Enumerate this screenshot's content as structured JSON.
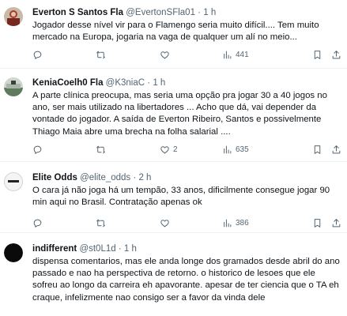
{
  "tweets": [
    {
      "name": "Everton S Santos Fla",
      "handle": "@EvertonSFla01",
      "separator": "·",
      "time": "1 h",
      "text": "Jogador desse nível vir para o Flamengo seria muito difícil.... Tem muito mercado na Europa, jogaria na vaga de qualquer um alí no meio...",
      "replies": "",
      "retweets": "",
      "likes": "",
      "views": "441",
      "avatar_color": "#a83a2e"
    },
    {
      "name": "KeniaCoelh0 Fla",
      "handle": "@K3niaC",
      "separator": "·",
      "time": "1 h",
      "text": "A parte clínica preocupa, mas seria uma opção pra jogar 30 a 40 jogos no ano, ser mais utilizado na libertadores ... Acho que dá, vai depender da vontade do jogador. A saída de Everton Ribeiro, Santos e possivelmente Thiago Maia abre uma brecha na folha salarial ....",
      "replies": "",
      "retweets": "",
      "likes": "2",
      "views": "635",
      "avatar_color": "#8a9a8c"
    },
    {
      "name": "Elite Odds",
      "handle": "@elite_odds",
      "separator": "·",
      "time": "2 h",
      "text": "O cara já não joga há um tempão, 33 anos, dificilmente consegue jogar 90 min aqui no Brasil. Contratação apenas ok",
      "replies": "",
      "retweets": "",
      "likes": "",
      "views": "386",
      "avatar_color": "#f2f2f2"
    },
    {
      "name": "indifferent",
      "handle": "@st0L1d",
      "separator": "·",
      "time": "1 h",
      "text": "dispensa comentarios, mas ele anda longe dos gramados desde abril do ano passado e nao ha perspectiva de retorno. o historico de lesoes que ele sofreu ao longo da carreira eh apavorante. apesar de ter ciencia que o TA eh craque, infelizmente nao consigo ser a favor da vinda dele",
      "avatar_color": "#0a0a0a"
    }
  ],
  "icons": {
    "reply": "reply-icon",
    "retweet": "retweet-icon",
    "like": "heart-icon",
    "views": "views-icon",
    "bookmark": "bookmark-icon",
    "share": "share-icon"
  },
  "colors": {
    "text": "#0f1419",
    "secondary": "#536471",
    "divider": "#eff3f4"
  }
}
